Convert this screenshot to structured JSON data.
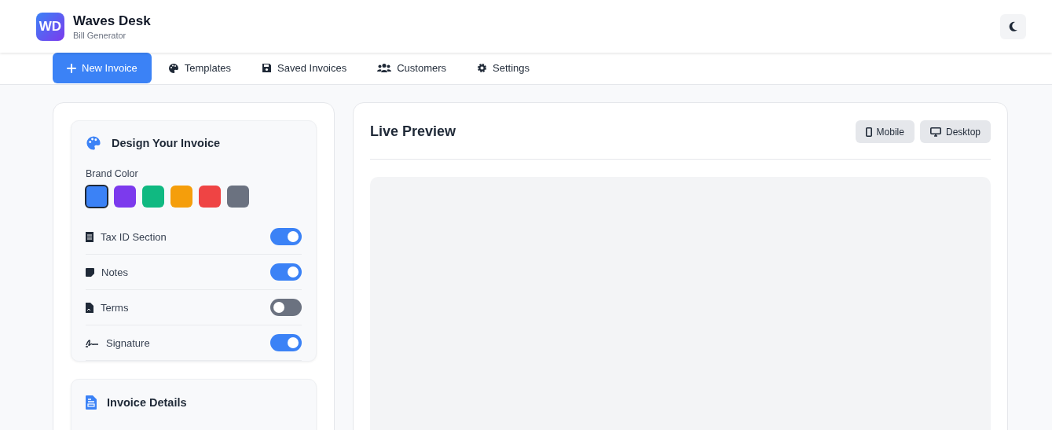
{
  "app": {
    "logo": "WD",
    "title": "Waves Desk",
    "subtitle": "Bill Generator"
  },
  "tabs": [
    {
      "label": "New Invoice",
      "selected": true
    },
    {
      "label": "Templates",
      "selected": false
    },
    {
      "label": "Saved Invoices",
      "selected": false
    },
    {
      "label": "Customers",
      "selected": false
    },
    {
      "label": "Settings",
      "selected": false
    }
  ],
  "design": {
    "title": "Design Your Invoice",
    "brand_label": "Brand Color",
    "colors": [
      {
        "color": "#3b82f6",
        "selected": true
      },
      {
        "color": "#7c3aed",
        "selected": false
      },
      {
        "color": "#10b981",
        "selected": false
      },
      {
        "color": "#f59e0b",
        "selected": false
      },
      {
        "color": "#ef4444",
        "selected": false
      },
      {
        "color": "#6b7280",
        "selected": false
      }
    ],
    "toggles": [
      {
        "label": "Tax ID Section",
        "on": true
      },
      {
        "label": "Notes",
        "on": true
      },
      {
        "label": "Terms",
        "on": false
      },
      {
        "label": "Signature",
        "on": true
      }
    ]
  },
  "details": {
    "title": "Invoice Details"
  },
  "preview": {
    "title": "Live Preview",
    "buttons": [
      {
        "label": "Mobile"
      },
      {
        "label": "Desktop"
      }
    ]
  }
}
